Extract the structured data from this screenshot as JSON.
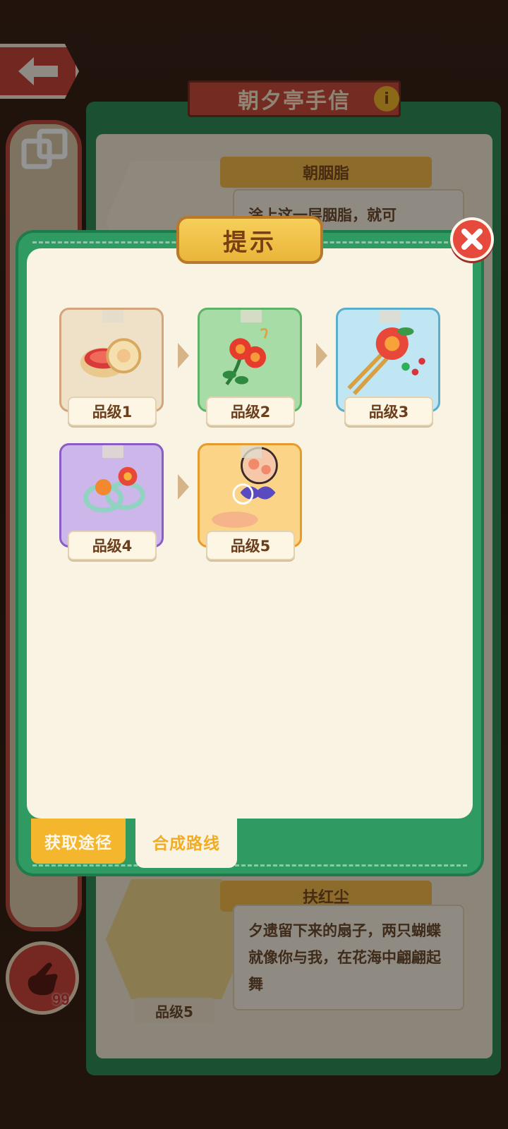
{
  "background": {
    "panel_title": "朝夕亭手信",
    "info_icon": "i",
    "top_card": {
      "name": "朝胭脂",
      "description": "涂上这一层胭脂，就可"
    },
    "bottom_card": {
      "name": "扶红尘",
      "description": "夕遗留下来的扇子，两只蝴蝶就像你与我，在花海中翩翩起舞",
      "grade": "品级5"
    },
    "hand_count": "99"
  },
  "modal": {
    "title": "提示",
    "close_icon": "close-x",
    "items": [
      {
        "grade": "品级1",
        "art": "rouge-compact",
        "bg": "#efe1c8",
        "border": "#d2a57a"
      },
      {
        "grade": "品级2",
        "art": "red-flower-earrings",
        "bg": "#a7dca7",
        "border": "#5fb26a"
      },
      {
        "grade": "品级3",
        "art": "flower-hairpin",
        "bg": "#bfe6f2",
        "border": "#5aaecb"
      },
      {
        "grade": "品级4",
        "art": "flower-bracelet",
        "bg": "#cdb6ea",
        "border": "#8a5cc8"
      },
      {
        "grade": "品级5",
        "art": "butterfly-fan",
        "bg": "#fcd488",
        "border": "#e69c2c"
      }
    ],
    "tabs": {
      "acquire": "获取途径",
      "synthesis": "合成路线"
    }
  },
  "colors": {
    "modal_green": "#2f9a62",
    "panel_cream": "#f9f3e3",
    "title_gold": "#eab53a",
    "close_red": "#e64a3c"
  }
}
